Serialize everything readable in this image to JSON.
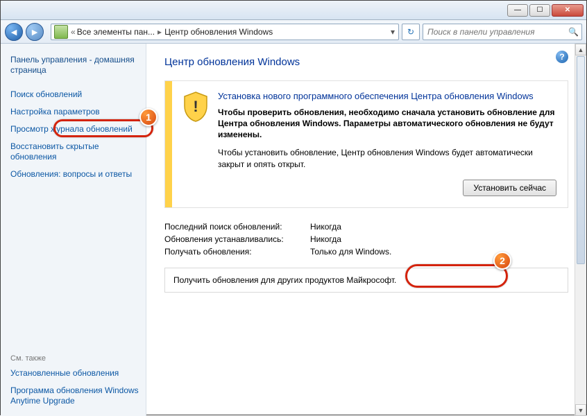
{
  "titlebar": {},
  "nav": {
    "breadcrumb1": "Все элементы пан...",
    "breadcrumb2": "Центр обновления Windows",
    "search_placeholder": "Поиск в панели управления"
  },
  "sidebar": {
    "home": "Панель управления - домашняя страница",
    "links": [
      "Поиск обновлений",
      "Настройка параметров",
      "Просмотр журнала обновлений",
      "Восстановить скрытые обновления",
      "Обновления: вопросы и ответы"
    ],
    "see_also_label": "См. также",
    "see_also_links": [
      "Установленные обновления",
      "Программа обновления Windows Anytime Upgrade"
    ]
  },
  "main": {
    "heading": "Центр обновления Windows",
    "notice_title": "Установка нового программного обеспечения Центра обновления Windows",
    "notice_bold": "Чтобы проверить обновления, необходимо сначала установить обновление для Центра обновления Windows. Параметры автоматического обновления не будут изменены.",
    "notice_plain": "Чтобы установить обновление, Центр обновления Windows будет автоматически закрыт и опять открыт.",
    "install_btn": "Установить сейчас",
    "status": [
      {
        "label": "Последний поиск обновлений:",
        "value": "Никогда"
      },
      {
        "label": "Обновления устанавливались:",
        "value": "Никогда"
      },
      {
        "label": "Получать обновления:",
        "value": "Только для Windows."
      }
    ],
    "footer": "Получить обновления для других продуктов Майкрософт."
  },
  "annotations": {
    "badge1": "1",
    "badge2": "2"
  }
}
